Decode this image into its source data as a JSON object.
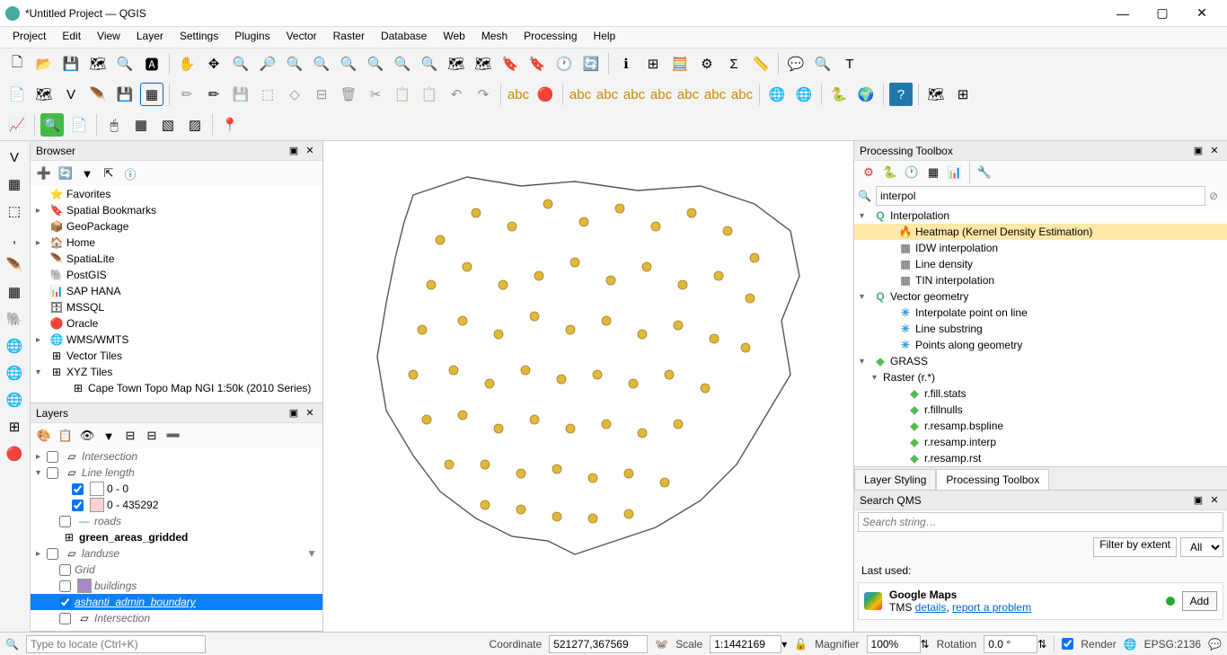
{
  "window": {
    "title": "*Untitled Project — QGIS"
  },
  "menubar": [
    "Project",
    "Edit",
    "View",
    "Layer",
    "Settings",
    "Plugins",
    "Vector",
    "Raster",
    "Database",
    "Web",
    "Mesh",
    "Processing",
    "Help"
  ],
  "browser": {
    "title": "Browser",
    "items": [
      {
        "icon": "⭐",
        "label": "Favorites",
        "expand": ""
      },
      {
        "icon": "🔖",
        "label": "Spatial Bookmarks",
        "expand": "▸"
      },
      {
        "icon": "📦",
        "label": "GeoPackage",
        "expand": ""
      },
      {
        "icon": "🏠",
        "label": "Home",
        "expand": "▸"
      },
      {
        "icon": "🪶",
        "label": "SpatiaLite",
        "expand": ""
      },
      {
        "icon": "🐘",
        "label": "PostGIS",
        "expand": ""
      },
      {
        "icon": "📊",
        "label": "SAP HANA",
        "expand": ""
      },
      {
        "icon": "🗄",
        "label": "MSSQL",
        "expand": ""
      },
      {
        "icon": "🔴",
        "label": "Oracle",
        "expand": ""
      },
      {
        "icon": "🌐",
        "label": "WMS/WMTS",
        "expand": "▸"
      },
      {
        "icon": "⊞",
        "label": "Vector Tiles",
        "expand": ""
      },
      {
        "icon": "⊞",
        "label": "XYZ Tiles",
        "expand": "▾"
      },
      {
        "icon": "⊞",
        "label": "Cape Town Topo Map NGI 1:50k (2010 Series)",
        "expand": "",
        "indent": 24
      }
    ]
  },
  "layers": {
    "title": "Layers",
    "items": [
      {
        "expand": "▸",
        "cb": false,
        "label": "Intersection",
        "italic": true,
        "icon": "▱"
      },
      {
        "expand": "▾",
        "cb": false,
        "label": "Line length",
        "italic": true,
        "icon": "▱"
      },
      {
        "indent": 28,
        "cb": true,
        "swatch": "#fff",
        "label": "0 - 0"
      },
      {
        "indent": 28,
        "cb": true,
        "swatch": "#fbd3d3",
        "label": "0 - 435292"
      },
      {
        "indent": 14,
        "cb": false,
        "swatch": "—",
        "label": "roads",
        "italic": true
      },
      {
        "indent": 14,
        "icon": "⊞",
        "label": "green_areas_gridded",
        "bold": true
      },
      {
        "expand": "▸",
        "cb": false,
        "icon": "▱",
        "label": "landuse",
        "italic": true,
        "filter": true
      },
      {
        "indent": 14,
        "cb": false,
        "label": "Grid",
        "italic": true
      },
      {
        "indent": 14,
        "cb": false,
        "swatch": "#a68ac6",
        "label": "buildings",
        "italic": true
      },
      {
        "indent": 14,
        "cb": true,
        "label": "ashanti_admin_boundary",
        "italic": true,
        "selected": true
      },
      {
        "indent": 14,
        "cb": false,
        "icon": "▱",
        "label": "Intersection",
        "italic": true
      }
    ]
  },
  "toolbox": {
    "title": "Processing Toolbox",
    "search_value": "interpol",
    "tree": [
      {
        "expand": "▾",
        "icon": "Q",
        "color": "#4a8",
        "label": "Interpolation"
      },
      {
        "indent": 28,
        "icon": "🔥",
        "label": "Heatmap (Kernel Density Estimation)",
        "hl": true
      },
      {
        "indent": 28,
        "icon": "▦",
        "label": "IDW interpolation"
      },
      {
        "indent": 28,
        "icon": "▦",
        "label": "Line density"
      },
      {
        "indent": 28,
        "icon": "▦",
        "label": "TIN interpolation"
      },
      {
        "expand": "▾",
        "icon": "Q",
        "color": "#4a8",
        "label": "Vector geometry"
      },
      {
        "indent": 28,
        "icon": "✳",
        "color": "#39c",
        "label": "Interpolate point on line"
      },
      {
        "indent": 28,
        "icon": "✳",
        "color": "#39c",
        "label": "Line substring"
      },
      {
        "indent": 28,
        "icon": "✳",
        "color": "#39c",
        "label": "Points along geometry"
      },
      {
        "expand": "▾",
        "icon": "◆",
        "color": "#5b5",
        "label": "GRASS"
      },
      {
        "expand": "▾",
        "indent": 14,
        "label": "Raster (r.*)"
      },
      {
        "indent": 38,
        "icon": "◆",
        "color": "#5b5",
        "label": "r.fill.stats"
      },
      {
        "indent": 38,
        "icon": "◆",
        "color": "#5b5",
        "label": "r.fillnulls"
      },
      {
        "indent": 38,
        "icon": "◆",
        "color": "#5b5",
        "label": "r.resamp.bspline"
      },
      {
        "indent": 38,
        "icon": "◆",
        "color": "#5b5",
        "label": "r.resamp.interp"
      },
      {
        "indent": 38,
        "icon": "◆",
        "color": "#5b5",
        "label": "r.resamp.rst"
      }
    ],
    "tabs": {
      "styling": "Layer Styling",
      "toolbox": "Processing Toolbox"
    }
  },
  "qms": {
    "title": "Search QMS",
    "placeholder": "Search string…",
    "filter_extent": "Filter by extent",
    "filter_all": "All",
    "last_used": "Last used:",
    "gm_title": "Google Maps",
    "gm_prefix": "TMS ",
    "gm_details": "details",
    "gm_report": "report a problem",
    "add": "Add"
  },
  "status": {
    "locate_placeholder": "Type to locate (Ctrl+K)",
    "coord_label": "Coordinate",
    "coord_value": "521277,367569",
    "scale_label": "Scale",
    "scale_value": "1:1442169",
    "magnifier_label": "Magnifier",
    "magnifier_value": "100%",
    "rotation_label": "Rotation",
    "rotation_value": "0.0 °",
    "render_label": "Render",
    "epsg": "EPSG:2136"
  }
}
